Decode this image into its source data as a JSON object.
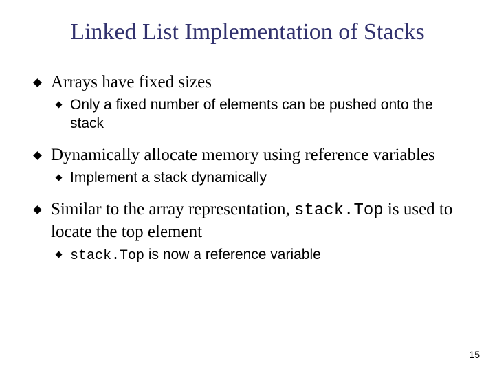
{
  "title": "Linked List Implementation of Stacks",
  "bullets": {
    "b1": "Arrays have fixed sizes",
    "b1a": "Only a fixed number of elements can be pushed onto the stack",
    "b2": "Dynamically allocate memory using reference variables",
    "b2a": "Implement a stack dynamically",
    "b3_pre": "Similar to the array representation, ",
    "b3_code": "stack.Top",
    "b3_post": " is used to locate the top element",
    "b3a_code": "stack.Top",
    "b3a_post": " is now a reference variable"
  },
  "page_number": "15"
}
